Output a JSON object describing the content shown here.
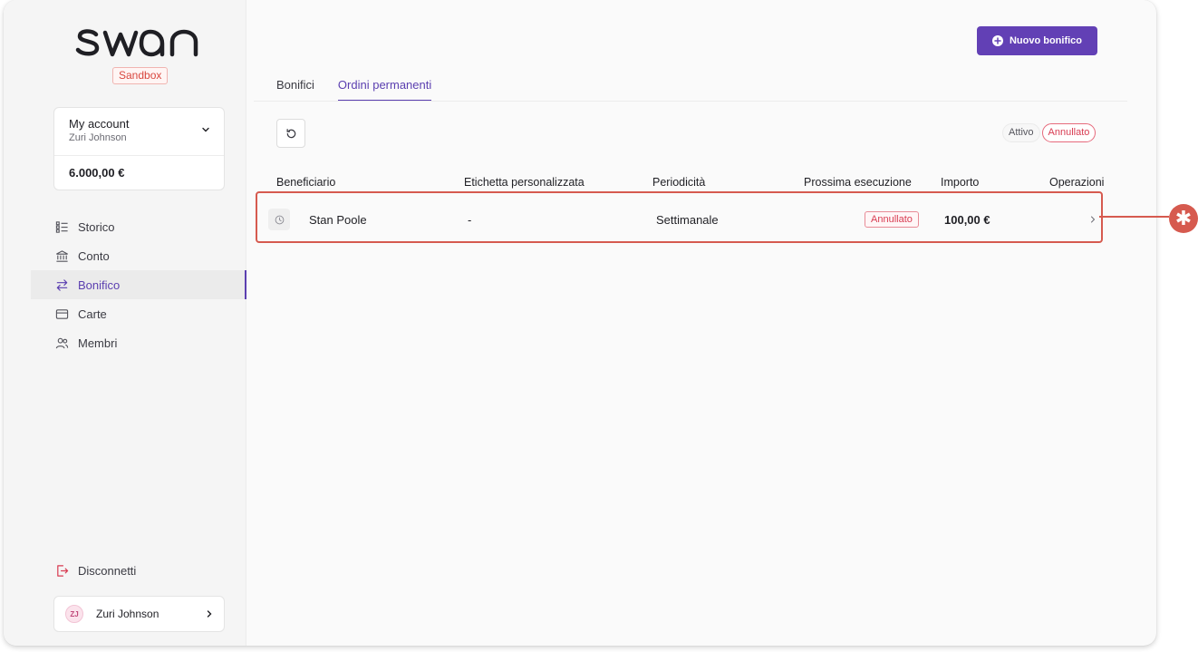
{
  "brand": {
    "sandbox_label": "Sandbox"
  },
  "account": {
    "name": "My account",
    "holder": "Zuri Johnson",
    "balance": "6.000,00 €"
  },
  "sidebar": {
    "items": [
      {
        "label": "Storico",
        "icon": "history-list-icon"
      },
      {
        "label": "Conto",
        "icon": "bank-icon"
      },
      {
        "label": "Bonifico",
        "icon": "transfer-arrows-icon",
        "active": true
      },
      {
        "label": "Carte",
        "icon": "card-icon"
      },
      {
        "label": "Membri",
        "icon": "members-icon"
      }
    ],
    "logout_label": "Disconnetti",
    "user": {
      "initials": "ZJ",
      "name": "Zuri Johnson"
    }
  },
  "header": {
    "new_transfer_label": "Nuovo bonifico"
  },
  "tabs": [
    {
      "label": "Bonifici",
      "active": false
    },
    {
      "label": "Ordini permanenti",
      "active": true
    }
  ],
  "filters": {
    "active_label": "Attivo",
    "cancelled_label": "Annullato"
  },
  "table": {
    "columns": [
      "Beneficiario",
      "Etichetta personalizzata",
      "Periodicità",
      "Prossima esecuzione",
      "Importo",
      "Operazioni"
    ],
    "rows": [
      {
        "beneficiary": "Stan Poole",
        "label": "-",
        "periodicity": "Settimanale",
        "status": "Annullato",
        "amount": "100,00 €"
      }
    ]
  },
  "annotation": {
    "symbol": "✱"
  },
  "colors": {
    "accent": "#6240b5",
    "danger": "#d83c52",
    "annotation": "#d65a4f"
  }
}
